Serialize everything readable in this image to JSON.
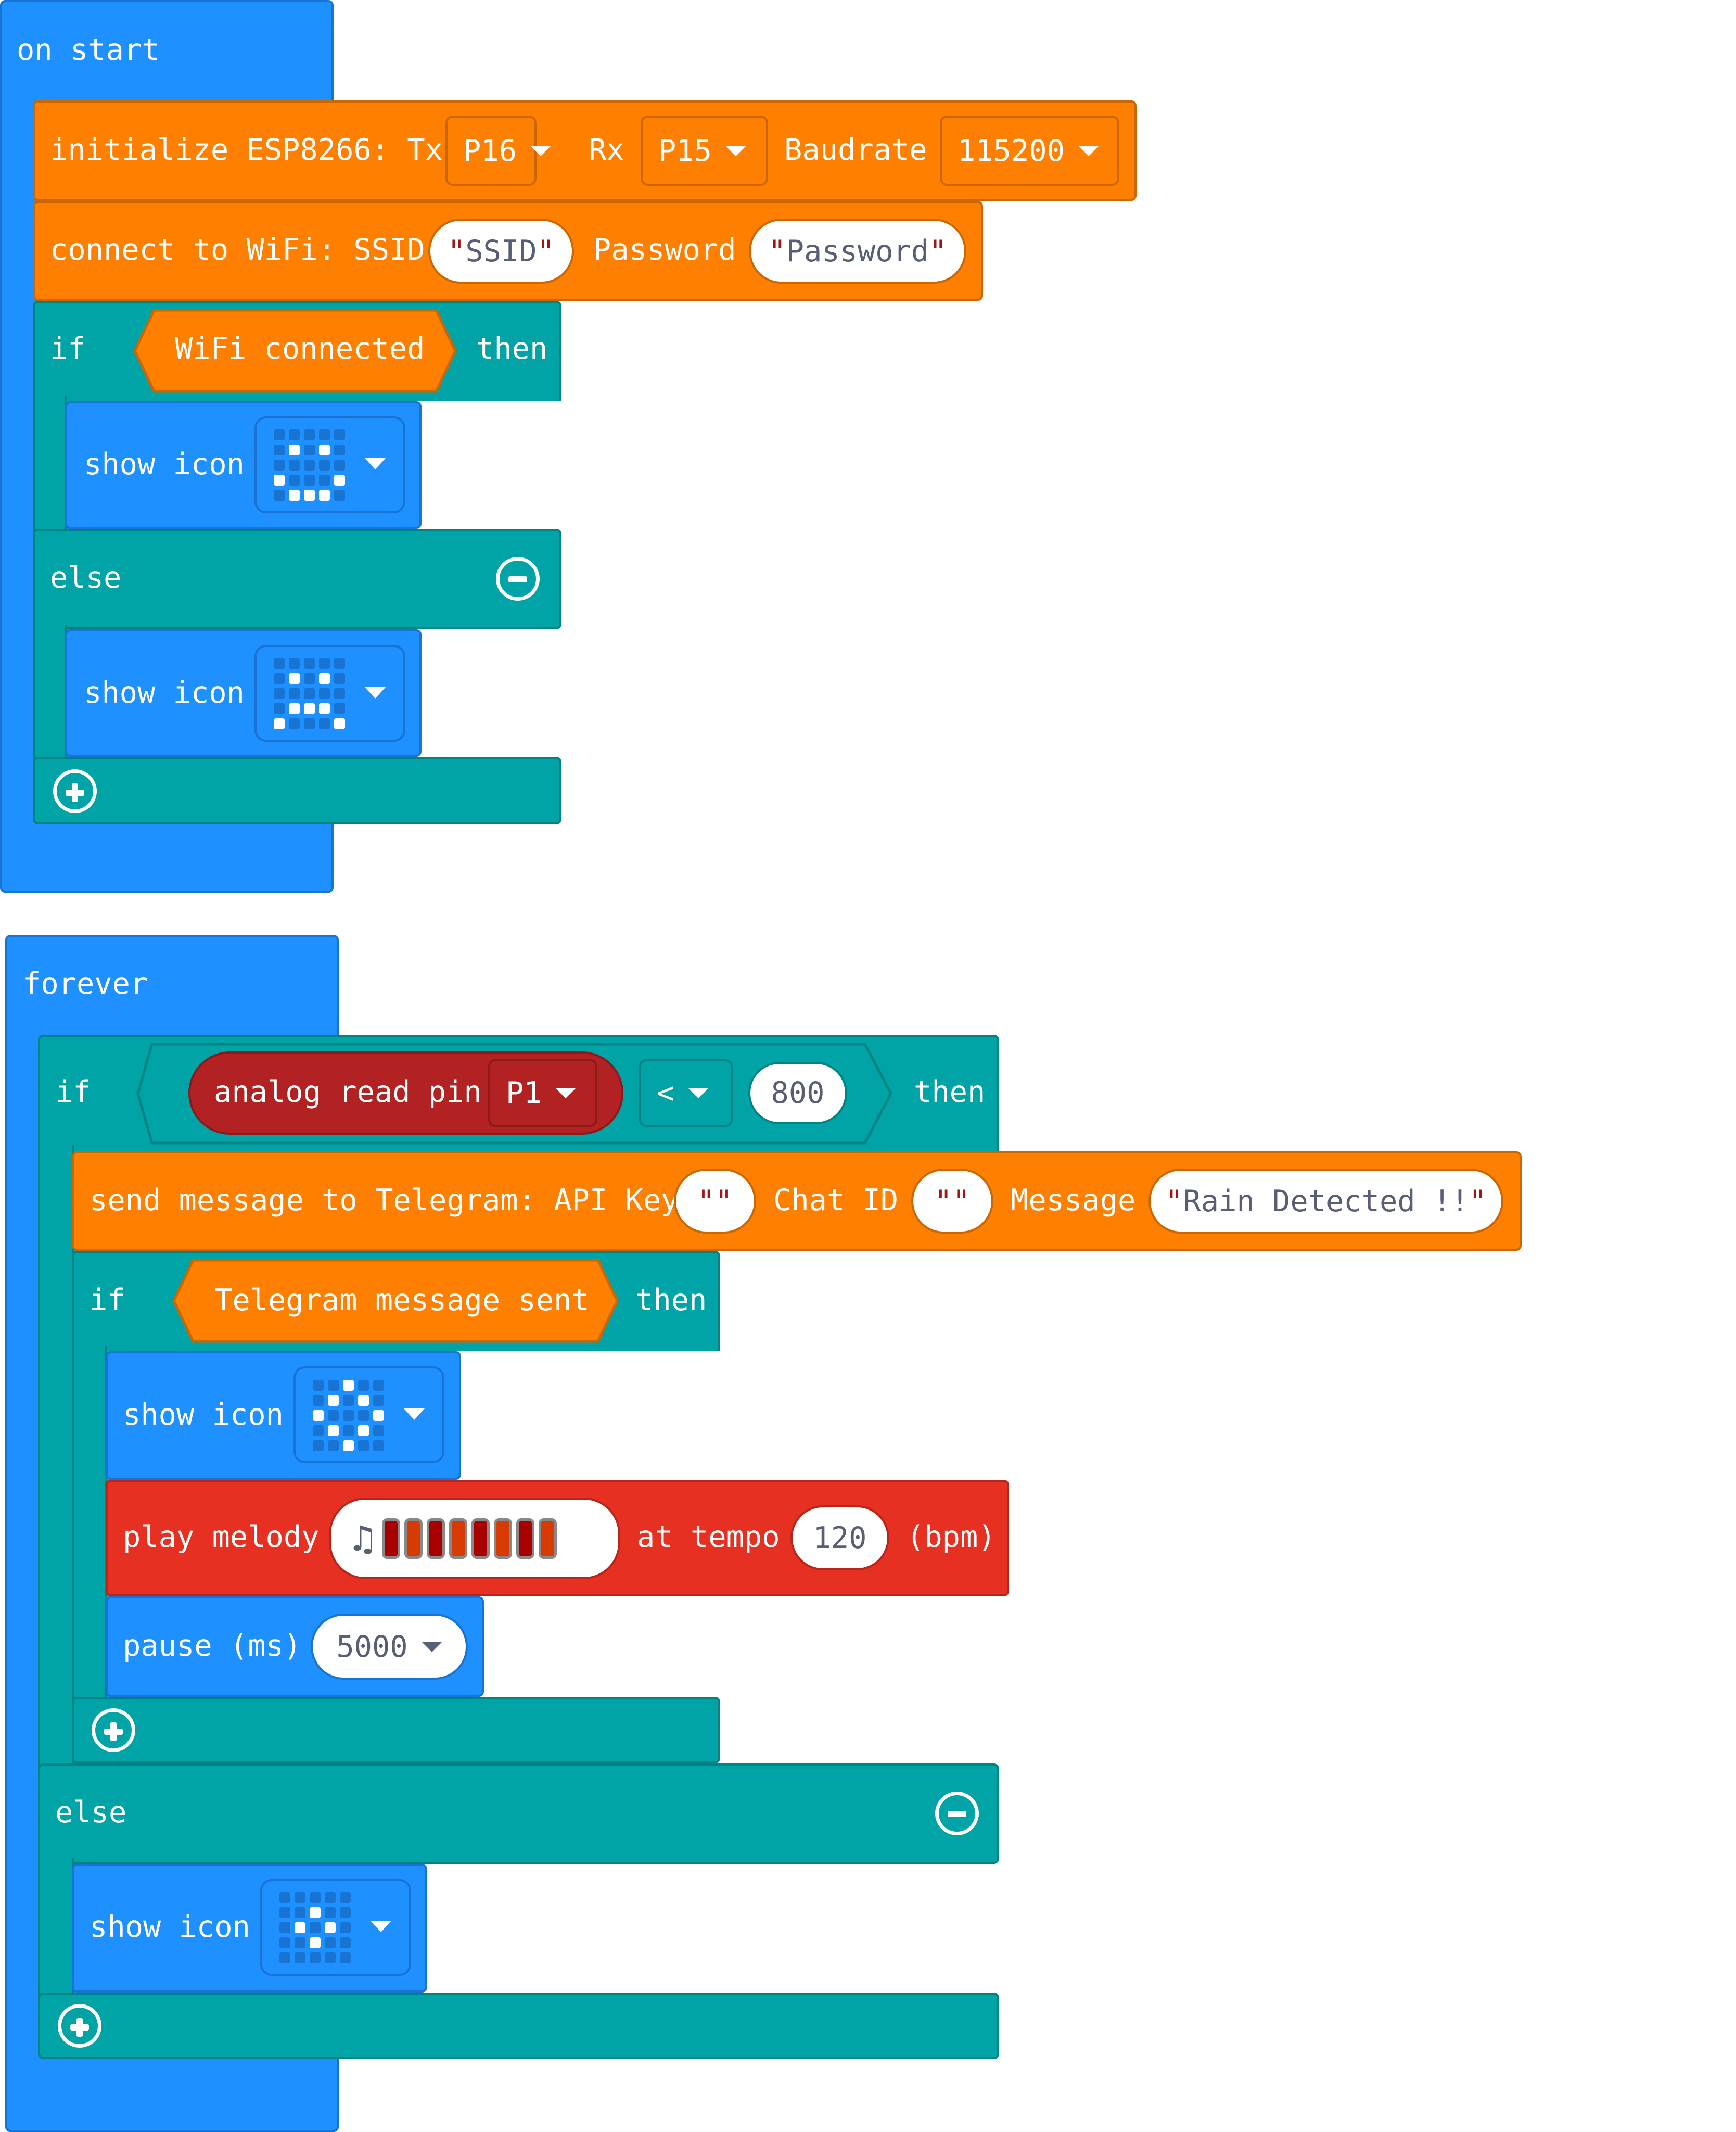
{
  "on_start": {
    "hat_label": "on start",
    "init_esp": {
      "label": "initialize ESP8266: Tx",
      "tx": "P16",
      "rx_label": "Rx",
      "rx": "P15",
      "baud_label": "Baudrate",
      "baud": "115200"
    },
    "connect_wifi": {
      "label": "connect to WiFi: SSID",
      "ssid": "SSID",
      "password_label": "Password",
      "password": "Password"
    },
    "if_block": {
      "if_label": "if",
      "condition": "WiFi connected",
      "then_label": "then",
      "else_label": "else"
    },
    "show_icon_then": {
      "label": "show icon",
      "icon": "happy-face-icon",
      "pixels": [
        0,
        0,
        0,
        0,
        0,
        0,
        1,
        0,
        1,
        0,
        0,
        0,
        0,
        0,
        0,
        1,
        0,
        0,
        0,
        1,
        0,
        1,
        1,
        1,
        0
      ]
    },
    "show_icon_else": {
      "label": "show icon",
      "icon": "sad-face-icon",
      "pixels": [
        0,
        0,
        0,
        0,
        0,
        0,
        1,
        0,
        1,
        0,
        0,
        0,
        0,
        0,
        0,
        0,
        1,
        1,
        1,
        0,
        1,
        0,
        0,
        0,
        1
      ]
    }
  },
  "forever": {
    "hat_label": "forever",
    "if_block": {
      "if_label": "if",
      "then_label": "then",
      "else_label": "else",
      "analog_label": "analog read pin",
      "pin": "P1",
      "operator": "<",
      "threshold": "800"
    },
    "telegram": {
      "label": "send message to Telegram: API Key",
      "api_key": "",
      "chat_label": "Chat ID",
      "chat_id": "",
      "message_label": "Message",
      "message": "Rain Detected !!"
    },
    "inner_if": {
      "if_label": "if",
      "condition": "Telegram message sent",
      "then_label": "then"
    },
    "show_icon_sent": {
      "label": "show icon",
      "icon": "diamond-icon",
      "pixels": [
        0,
        0,
        1,
        0,
        0,
        0,
        1,
        0,
        1,
        0,
        1,
        0,
        0,
        0,
        1,
        0,
        1,
        0,
        1,
        0,
        0,
        0,
        1,
        0,
        0
      ]
    },
    "play_melody": {
      "label": "play melody",
      "tempo_label": "at tempo",
      "tempo": "120",
      "unit": "(bpm)",
      "notes": [
        "#a80000",
        "#d83b01",
        "#a80000",
        "#d83b01",
        "#a80000",
        "#d83b01",
        "#a80000",
        "#d83b01"
      ]
    },
    "pause": {
      "label": "pause (ms)",
      "value": "5000"
    },
    "show_icon_else": {
      "label": "show icon",
      "icon": "small-diamond-icon",
      "pixels": [
        0,
        0,
        0,
        0,
        0,
        0,
        0,
        1,
        0,
        0,
        0,
        1,
        0,
        1,
        0,
        0,
        0,
        1,
        0,
        0,
        0,
        0,
        0,
        0,
        0
      ]
    }
  },
  "colors": {
    "basic": "#1e90ff",
    "esp": "#ff8000",
    "logic": "#00a4a6",
    "music": "#e63022",
    "pins": "#b22222"
  }
}
